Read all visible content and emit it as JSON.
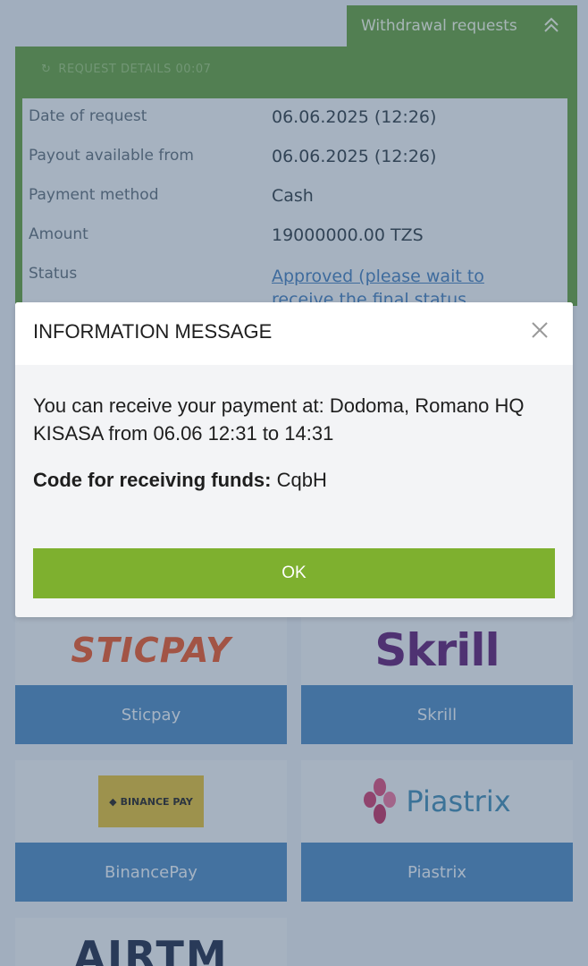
{
  "tab": {
    "label": "Withdrawal requests"
  },
  "request": {
    "header_text": "REQUEST DETAILS 00:07",
    "rows": [
      {
        "label": "Date of request",
        "value": "06.06.2025 (12:26)"
      },
      {
        "label": "Payout available from",
        "value": "06.06.2025 (12:26)"
      },
      {
        "label": "Payment method",
        "value": "Cash"
      },
      {
        "label": "Amount",
        "value": "19000000.00 TZS"
      },
      {
        "label": "Status",
        "value": "Approved (please wait to receive the final status"
      }
    ]
  },
  "payment_methods": [
    {
      "logo_text": "STICPAY",
      "button": "Sticpay"
    },
    {
      "logo_text": "Skrill",
      "button": "Skrill"
    },
    {
      "logo_text": "BINANCE PAY",
      "button": "BinancePay"
    },
    {
      "logo_text": "Piastrix",
      "button": "Piastrix"
    },
    {
      "logo_text": "AIRTM",
      "button": ""
    }
  ],
  "modal": {
    "title": "INFORMATION MESSAGE",
    "message": "You can receive your payment at: Dodoma, Romano HQ KISASA from 06.06 12:31 to 14:31",
    "code_label": "Code for receiving funds:",
    "code_value": "CqbH",
    "ok_label": "OK"
  },
  "colors": {
    "panel_green": "#5f9a40",
    "button_blue": "#4a85bd",
    "ok_green": "#7eb02f"
  }
}
